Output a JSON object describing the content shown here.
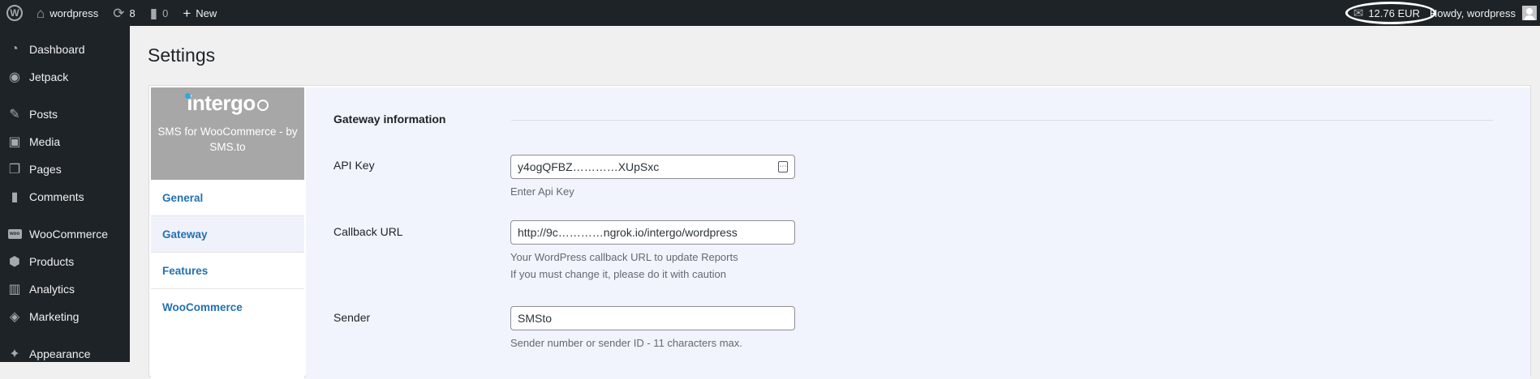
{
  "adminbar": {
    "site_name": "wordpress",
    "updates_count": "8",
    "comments_count": "0",
    "new_label": "New",
    "balance": "12.76 EUR",
    "howdy": "Howdy, wordpress"
  },
  "sidebar": {
    "items": [
      {
        "label": "Dashboard",
        "icon": "dashboard-icon"
      },
      {
        "label": "Jetpack",
        "icon": "jetpack-icon"
      },
      {
        "label": "Posts",
        "icon": "pin-icon"
      },
      {
        "label": "Media",
        "icon": "media-icon"
      },
      {
        "label": "Pages",
        "icon": "pages-icon"
      },
      {
        "label": "Comments",
        "icon": "comments-icon"
      },
      {
        "label": "WooCommerce",
        "icon": "woo-icon"
      },
      {
        "label": "Products",
        "icon": "products-icon"
      },
      {
        "label": "Analytics",
        "icon": "analytics-icon"
      },
      {
        "label": "Marketing",
        "icon": "marketing-icon"
      },
      {
        "label": "Appearance",
        "icon": "appearance-icon"
      }
    ]
  },
  "page": {
    "title": "Settings"
  },
  "plugin": {
    "logo_text": "intergo",
    "subtitle": "SMS for WooCommerce - by SMS.to",
    "nav": [
      "General",
      "Gateway",
      "Features",
      "WooCommerce"
    ]
  },
  "form": {
    "section_title": "Gateway information",
    "api_key_label": "API Key",
    "api_key_value": "y4ogQFBZ…………XUpSxc",
    "api_key_desc": "Enter Api Key",
    "callback_label": "Callback URL",
    "callback_value": "http://9c…………ngrok.io/intergo/wordpress",
    "callback_desc_1": "Your WordPress callback URL to update Reports",
    "callback_desc_2": "If you must change it, please do it with caution",
    "sender_label": "Sender",
    "sender_value": "SMSto",
    "sender_desc": "Sender number or sender ID - 11 characters max."
  },
  "colors": {
    "adminbar_bg": "#1d2327",
    "link": "#2271b1",
    "panel_bg": "#f1f4fc",
    "brand_bg": "#a7a7a7"
  }
}
